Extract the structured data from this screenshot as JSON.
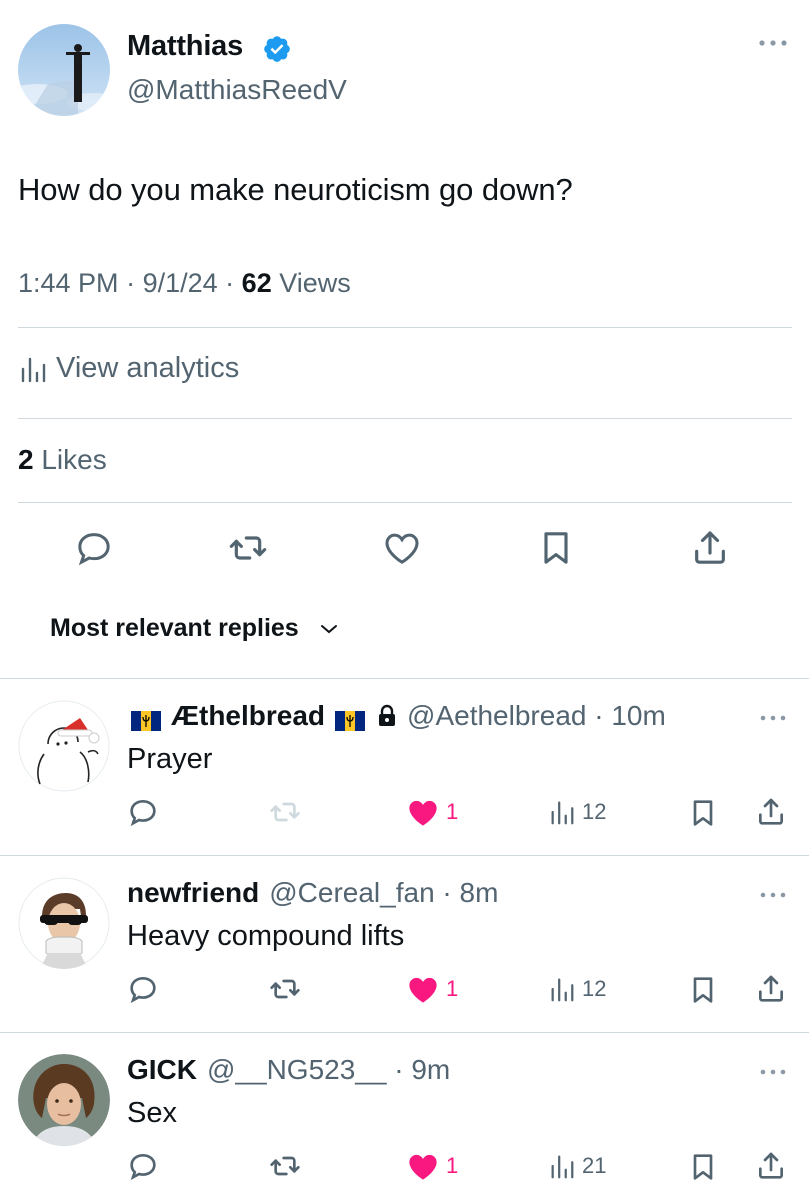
{
  "tweet": {
    "author_name": "Matthias",
    "author_handle": "@MatthiasReedV",
    "text": "How do you make neuroticism go down?",
    "time": "1:44 PM",
    "date": "9/1/24",
    "views_count": "62",
    "views_label": "Views",
    "analytics_label": "View analytics",
    "likes_count": "2",
    "likes_label": "Likes"
  },
  "sort_label": "Most relevant replies",
  "replies": [
    {
      "name": "Æthelbread",
      "handle": "@Aethelbread",
      "time": "10m",
      "text": "Prayer",
      "likes": "1",
      "views": "12"
    },
    {
      "name": "newfriend",
      "handle": "@Cereal_fan",
      "time": "8m",
      "text": "Heavy compound lifts",
      "likes": "1",
      "views": "12"
    },
    {
      "name": "GICK",
      "handle": "@__NG523__",
      "time": "9m",
      "text": "Sex",
      "likes": "1",
      "views": "21"
    }
  ],
  "colors": {
    "text": "#0f1419",
    "muted": "#536471",
    "verified": "#1d9bf0",
    "like": "#f91880",
    "divider": "#cfd9de"
  }
}
